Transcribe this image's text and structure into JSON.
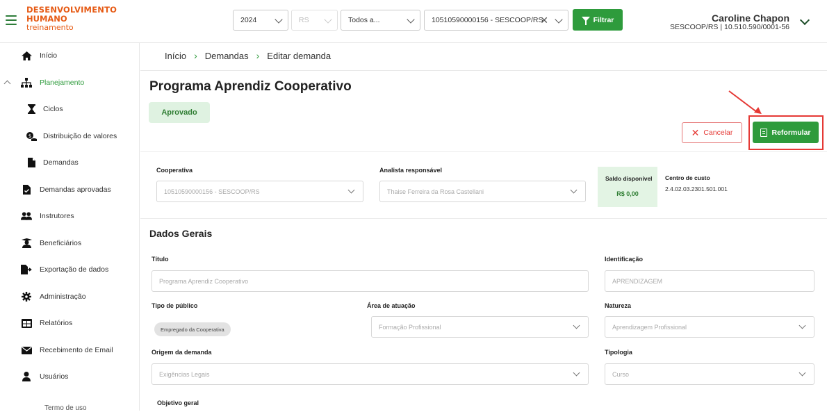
{
  "logo": {
    "line1": "DESENVOLVIMENTO",
    "line2": "HUMANO",
    "line3": "treinamento"
  },
  "filters": {
    "year": "2024",
    "state": "RS",
    "scope": "Todos a...",
    "cooperative": "10510590000156 - SESCOOP/RS",
    "filter_label": "Filtrar"
  },
  "user": {
    "name": "Caroline Chapon",
    "org": "SESCOOP/RS | 10.510.590/0001-56"
  },
  "sidebar": {
    "items": [
      {
        "label": "Início",
        "icon": "home-icon"
      },
      {
        "label": "Planejamento",
        "icon": "hierarchy-icon"
      },
      {
        "label": "Ciclos",
        "icon": "hourglass-icon"
      },
      {
        "label": "Distribuição de valores",
        "icon": "money-hand-icon"
      },
      {
        "label": "Demandas",
        "icon": "file-icon"
      },
      {
        "label": "Demandas aprovadas",
        "icon": "file-check-icon"
      },
      {
        "label": "Instrutores",
        "icon": "users-icon"
      },
      {
        "label": "Beneficiários",
        "icon": "graduate-icon"
      },
      {
        "label": "Exportação de dados",
        "icon": "file-export-icon"
      },
      {
        "label": "Administração",
        "icon": "gear-icon"
      },
      {
        "label": "Relatórios",
        "icon": "table-icon"
      },
      {
        "label": "Recebimento de Email",
        "icon": "envelope-icon"
      },
      {
        "label": "Usuários",
        "icon": "user-icon"
      }
    ],
    "terms": "Termo de uso"
  },
  "breadcrumb": {
    "home": "Início",
    "section": "Demandas",
    "current": "Editar demanda"
  },
  "page": {
    "title": "Programa Aprendiz Cooperativo",
    "status": "Aprovado",
    "cancel_label": "Cancelar",
    "reform_label": "Reformular"
  },
  "header_fields": {
    "cooperativa_label": "Cooperativa",
    "cooperativa_value": "10510590000156 - SESCOOP/RS",
    "analista_label": "Analista responsável",
    "analista_value": "Thaise Ferreira da Rosa Castellani",
    "saldo_label": "Saldo disponível",
    "saldo_value": "R$ 0,00",
    "centro_label": "Centro de custo",
    "centro_value": "2.4.02.03.2301.501.001"
  },
  "dados_gerais": {
    "title": "Dados Gerais",
    "titulo_label": "Título",
    "titulo_value": "Programa Aprendiz Cooperativo",
    "identificacao_label": "Identificação",
    "identificacao_value": "APRENDIZAGEM",
    "publico_label": "Tipo de público",
    "publico_chip": "Empregado da Cooperativa",
    "area_label": "Área de atuação",
    "area_value": "Formação Profissional",
    "natureza_label": "Natureza",
    "natureza_value": "Aprendizagem Profissional",
    "origem_label": "Origem da demanda",
    "origem_value": "Exigências Legais",
    "tipologia_label": "Tipologia",
    "tipologia_value": "Curso",
    "objetivo_label": "Objetivo geral"
  },
  "colors": {
    "brand_green": "#2e9b3c",
    "brand_orange": "#e65a14",
    "danger": "#e53935"
  }
}
